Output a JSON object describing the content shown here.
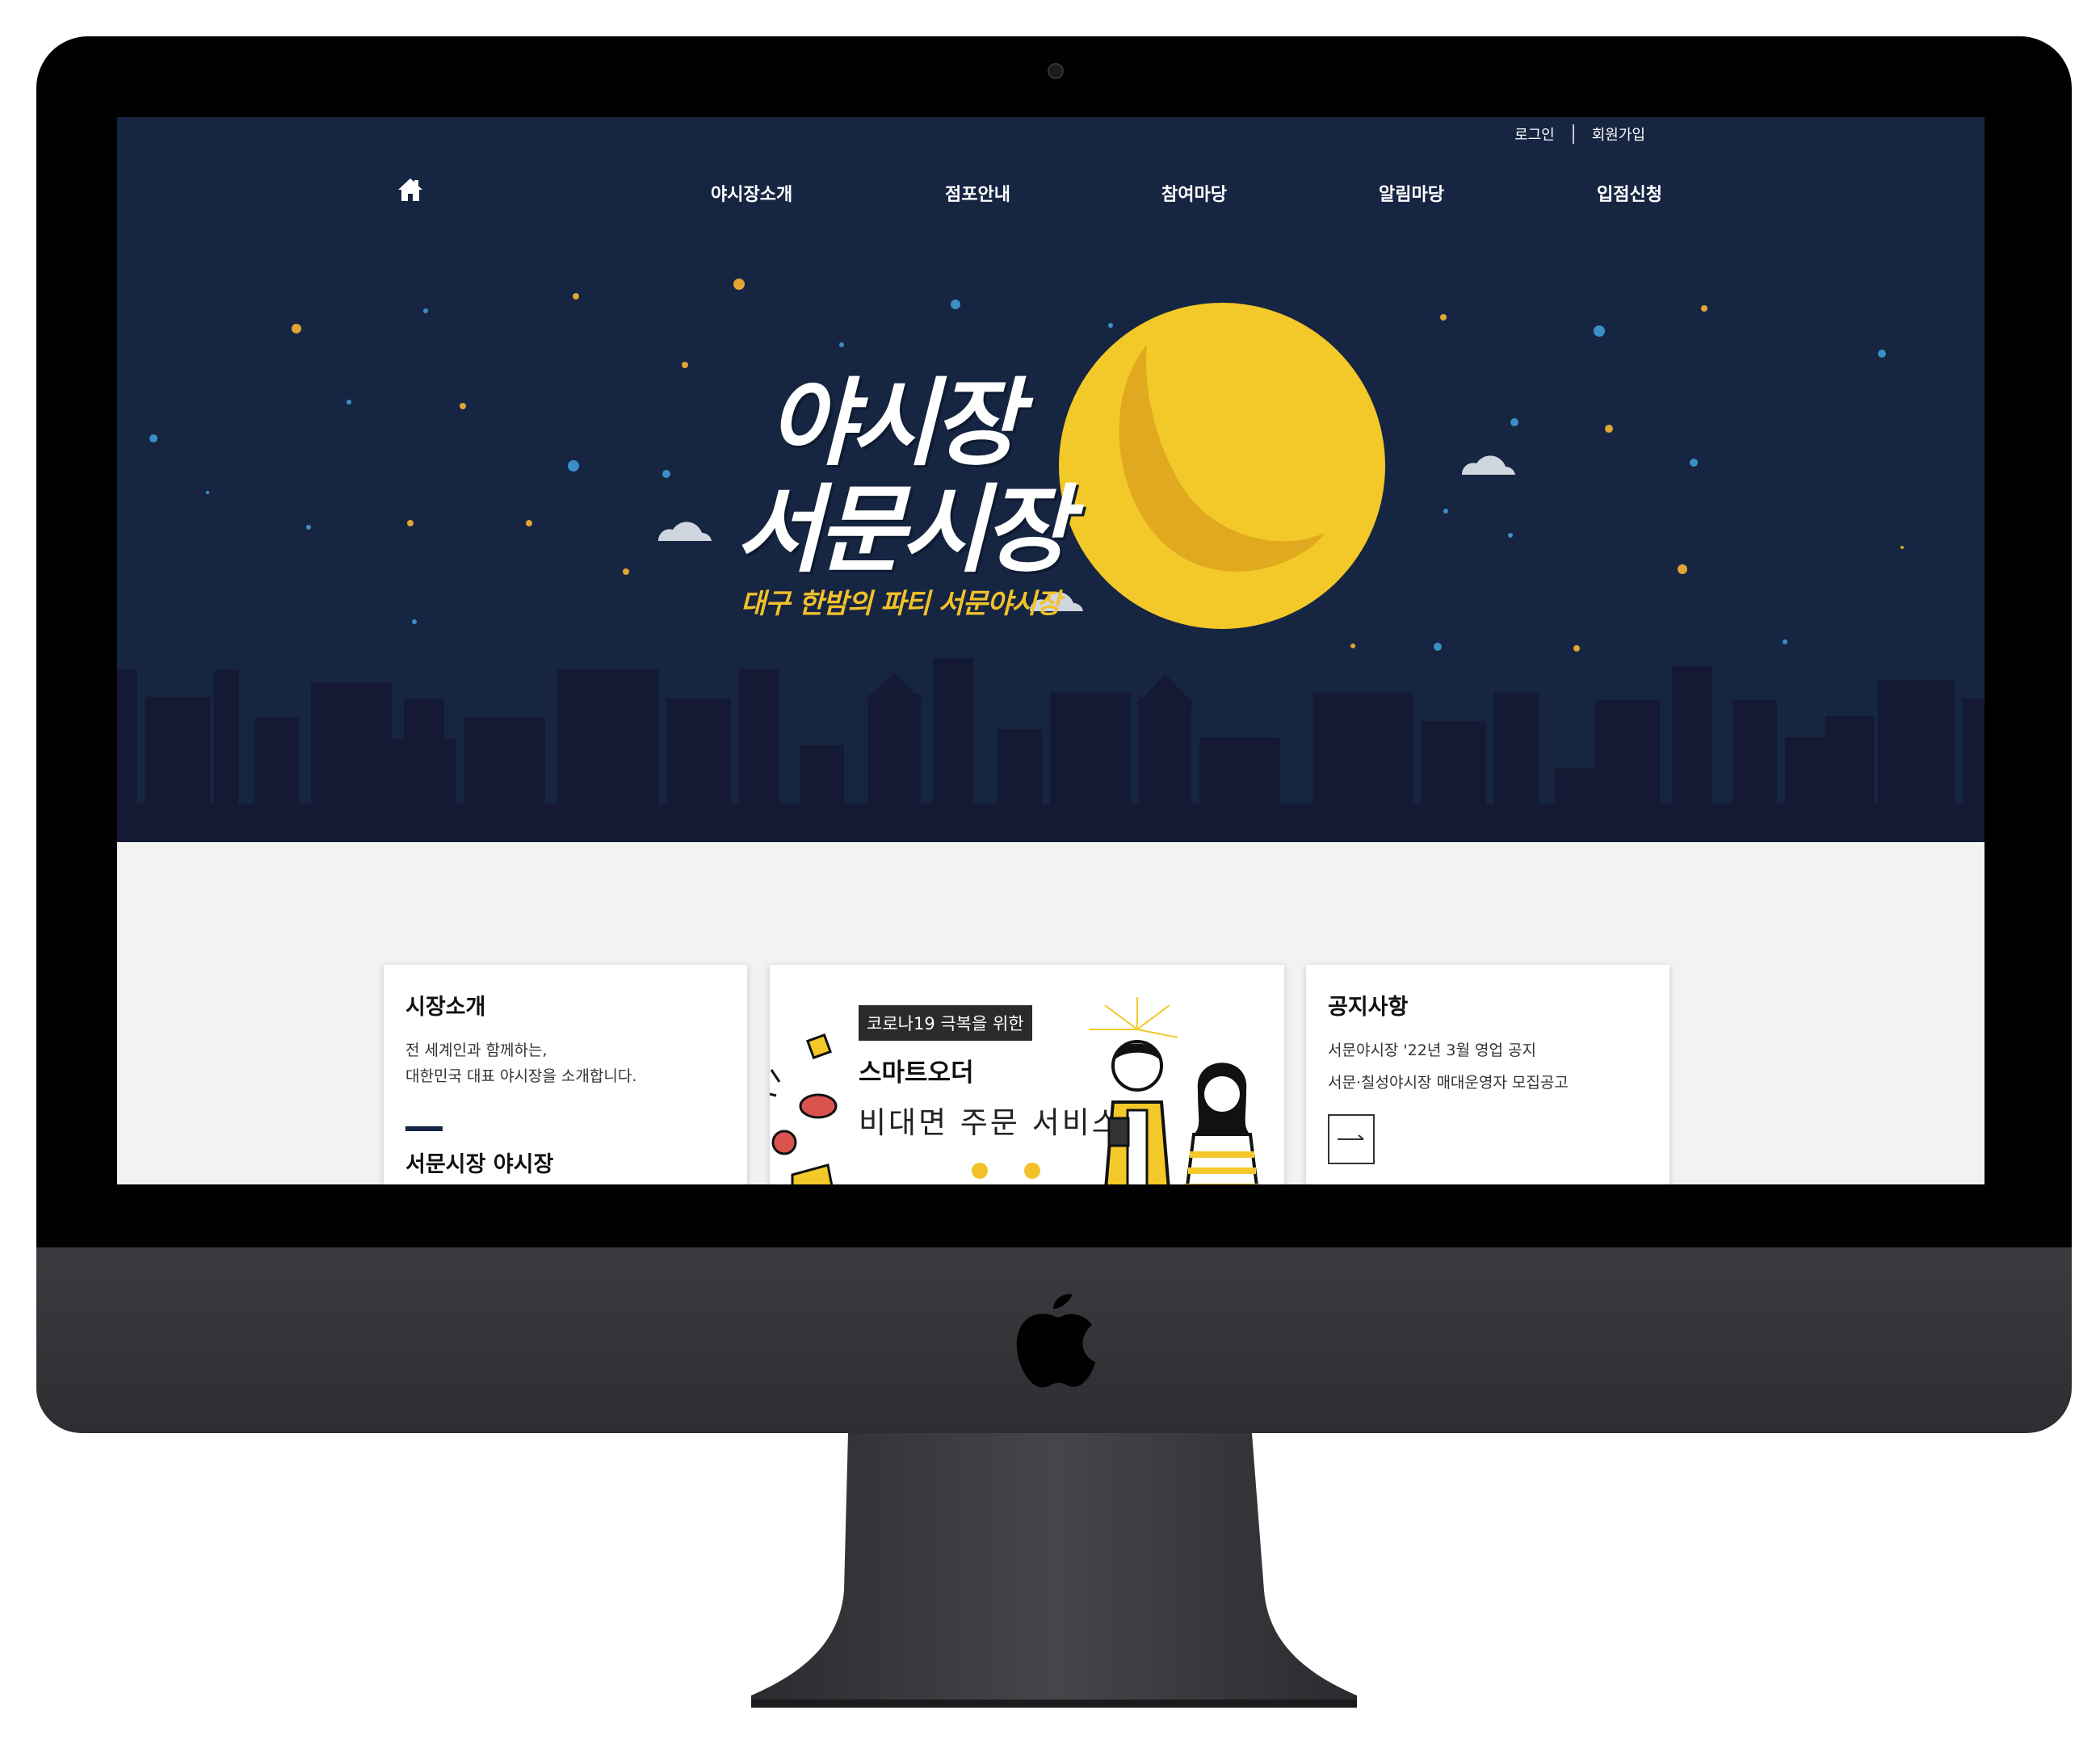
{
  "utility_nav": {
    "login": "로그인",
    "signup": "회원가입"
  },
  "gnb": {
    "home_icon": "home-icon",
    "items": [
      "야시장소개",
      "점포안내",
      "참여마당",
      "알림마당",
      "입점신청"
    ]
  },
  "hero": {
    "title_line1": "야시장",
    "title_line2": "서문시장",
    "subtitle": "대구 한밤의 파티 서문야시장",
    "colors": {
      "sky": "#162541",
      "moon": "#f2c929",
      "city": "#141a33",
      "accent": "#f2c12a"
    }
  },
  "cards": {
    "intro": {
      "title": "시장소개",
      "line1": "전 세계인과 함께하는,",
      "line2": "대한민국 대표 야시장을 소개합니다.",
      "section_title": "서문시장 야시장"
    },
    "promo": {
      "tag": "코로나19 극복을 위한",
      "heading": "스마트오더",
      "sub": "비대면 주문 서비스"
    },
    "notice": {
      "title": "공지사항",
      "items": [
        "서문야시장 '22년 3월 영업 공지",
        "서문·칠성야시장 매대운영자 모집공고"
      ],
      "more_icon": "arrow-right-icon"
    }
  }
}
